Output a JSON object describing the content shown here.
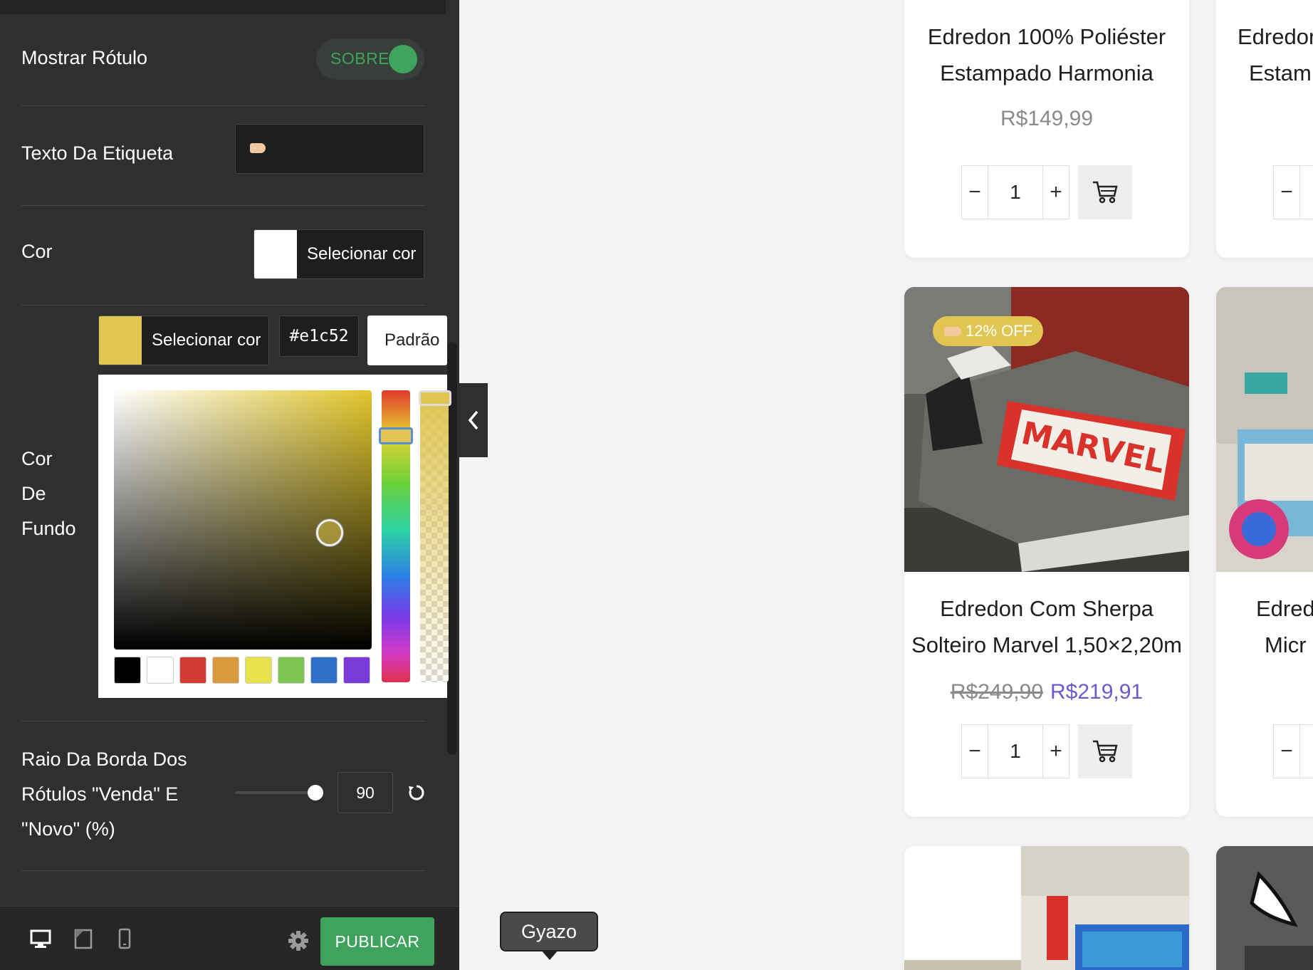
{
  "sidebar": {
    "show_label": {
      "label": "Mostrar Rótulo",
      "toggle_text": "SOBRE"
    },
    "label_text": {
      "label": "Texto Da Etiqueta"
    },
    "color": {
      "label": "Cor",
      "button_label": "Selecionar cor",
      "swatch": "#ffffff"
    },
    "background_color": {
      "label_lines": [
        "Cor",
        "De",
        "Fundo"
      ],
      "button_label": "Selecionar cor",
      "hex": "#e1c52",
      "default_label": "Padrão",
      "swatch": "#e1c552",
      "presets": [
        "#000000",
        "#ffffff",
        "#d33a33",
        "#d99a3e",
        "#e8e24a",
        "#7cc552",
        "#2e6fc7",
        "#7a3ad9"
      ]
    },
    "border_radius": {
      "label_lines": [
        "Raio Da Borda Dos",
        "Rótulos \"Venda\" E",
        "\"Novo\" (%)"
      ],
      "value": "90"
    },
    "publish_label": "PUBLICAR"
  },
  "tooltip": {
    "text": "Gyazo"
  },
  "products": [
    {
      "title_lines": [
        "Edredon 100% Poliéster",
        "Estampado Harmonia"
      ],
      "price": "R$149,99",
      "qty": "1"
    },
    {
      "title_lines": [
        "Edredon Com Sherpa",
        "Solteiro Marvel 1,50×2,20m"
      ],
      "old_price": "R$249,90",
      "new_price": "R$219,91",
      "qty": "1",
      "badge": "12% OFF"
    }
  ],
  "products_partial": [
    {
      "title_lines": [
        "Edredon",
        "Estam"
      ]
    },
    {
      "title_lines": [
        "Edred",
        "Micr"
      ]
    }
  ],
  "steppers": {
    "minus": "−",
    "plus": "+"
  },
  "colors": {
    "accent_green": "#3fa35e",
    "badge_yellow": "#e1c552",
    "sale_price": "#6a5acd"
  }
}
